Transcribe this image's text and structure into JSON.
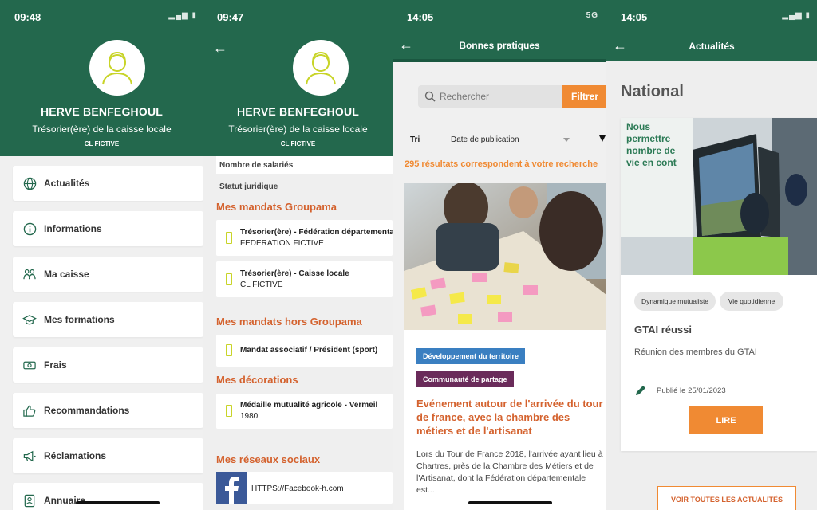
{
  "profile": {
    "name": "HERVE BENFEGHOUL",
    "role": "Trésorier(ère) de la caisse locale",
    "caisse": "CL FICTIVE"
  },
  "colors": {
    "brand_green": "#23684d",
    "accent_orange": "#f08a33",
    "title_orange": "#d4622e",
    "lime": "#c8d428",
    "tag_blue": "#3a7fc1",
    "tag_purple": "#6a2b5a"
  },
  "screen1": {
    "time": "09:48",
    "menu": [
      {
        "label": "Actualités",
        "icon": "globe-icon"
      },
      {
        "label": "Informations",
        "icon": "info-icon"
      },
      {
        "label": "Ma caisse",
        "icon": "people-icon"
      },
      {
        "label": "Mes formations",
        "icon": "graduation-cap-icon"
      },
      {
        "label": "Frais",
        "icon": "money-icon"
      },
      {
        "label": "Recommandations",
        "icon": "thumbs-up-icon"
      },
      {
        "label": "Réclamations",
        "icon": "megaphone-icon"
      },
      {
        "label": "Annuaire",
        "icon": "contact-book-icon"
      }
    ]
  },
  "screen2": {
    "time": "09:47",
    "fields": [
      "Nombre de salariés",
      "Statut juridique"
    ],
    "section_mandats": "Mes mandats Groupama",
    "mandats": [
      {
        "title": "Trésorier(ère) - Fédération départementale",
        "sub": "FEDERATION FICTIVE"
      },
      {
        "title": "Trésorier(ère) - Caisse locale",
        "sub": "CL FICTIVE"
      }
    ],
    "section_hors": "Mes mandats hors Groupama",
    "hors": [
      {
        "title": "Mandat associatif / Président (sport)"
      }
    ],
    "section_decorations": "Mes décorations",
    "decorations": [
      {
        "title": "Médaille mutualité agricole - Vermeil",
        "sub": "1980"
      }
    ],
    "section_reseaux": "Mes réseaux sociaux",
    "reseau_url": "HTTPS://Facebook-h.com"
  },
  "screen3": {
    "time": "14:05",
    "network": "5G",
    "title": "Bonnes pratiques",
    "search_placeholder": "Rechercher",
    "filter_label": "Filtrer",
    "sort_label": "Tri",
    "sort_value": "Date de publication",
    "results_text": "295 résultats correspondent à votre recherche",
    "tags": [
      "Développement du territoire",
      "Communauté de partage"
    ],
    "article_title": "Evénement autour de l'arrivée du tour de france, avec la chambre des métiers et de l'artisanat",
    "article_body": "Lors du Tour de France 2018, l'arrivée ayant lieu à Chartres, près de la Chambre des Métiers et de l'Artisanat, dont la Fédération départementale est..."
  },
  "screen4": {
    "time": "14:05",
    "title": "Actualités",
    "section": "National",
    "photo_text": [
      "Nous",
      "permettre",
      "nombre de",
      "vie en cont"
    ],
    "chips": [
      "Dynamique mutualiste",
      "Vie quotidienne"
    ],
    "news_title": "GTAI réussi",
    "news_desc": "Réunion des membres du GTAI",
    "published": "Publié le 25/01/2023",
    "read_label": "LIRE",
    "see_all_label": "VOIR TOUTES LES ACTUALITÉS"
  }
}
